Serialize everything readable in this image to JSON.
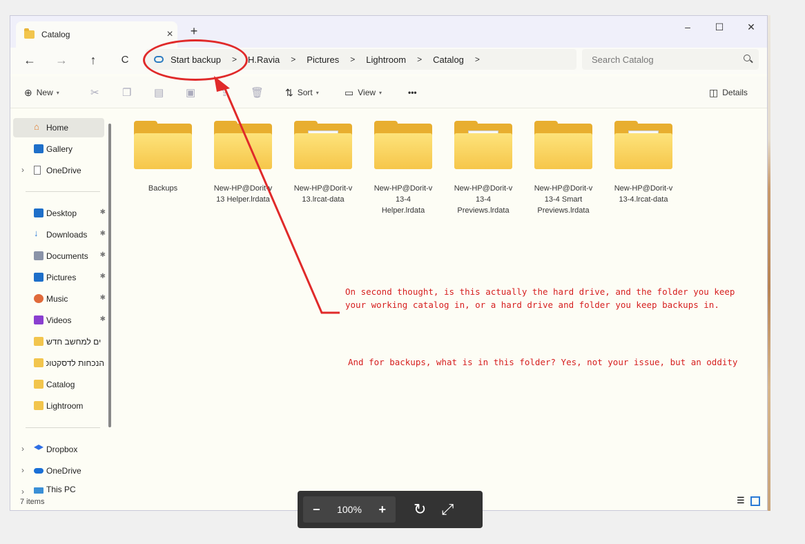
{
  "window": {
    "tab_title": "Catalog",
    "tab_close": "×",
    "new_tab": "+",
    "minimize": "–",
    "maximize": "☐",
    "close": "✕"
  },
  "nav": {
    "back": "←",
    "forward": "→",
    "up": "↑",
    "refresh": "C",
    "breadcrumb": [
      "Start backup",
      "H.Ravia",
      "Pictures",
      "Lightroom",
      "Catalog"
    ],
    "separator": ">",
    "search_placeholder": "Search Catalog"
  },
  "toolbar": {
    "new": "New",
    "sort": "Sort",
    "view": "View",
    "more": "•••",
    "details": "Details"
  },
  "sidebar": {
    "home": "Home",
    "gallery": "Gallery",
    "onedrive_top": "OneDrive",
    "desktop": "Desktop",
    "downloads": "Downloads",
    "documents": "Documents",
    "pictures": "Pictures",
    "music": "Music",
    "videos": "Videos",
    "hebrew_folder_1": "ים למחשב חדש",
    "hebrew_folder_2": "הנכחות לדסקטופ",
    "catalog": "Catalog",
    "lightroom": "Lightroom",
    "dropbox": "Dropbox",
    "onedrive_bottom": "OneDrive",
    "this_pc": "This PC",
    "pin": "📌"
  },
  "folders": [
    {
      "line1": "Backups",
      "line2": "",
      "line3": "",
      "variant": "plain"
    },
    {
      "line1": "New-HP@Dorit-v",
      "line2": "13 Helper.lrdata",
      "line3": "",
      "variant": "plain"
    },
    {
      "line1": "New-HP@Dorit-v",
      "line2": "13.lrcat-data",
      "line3": "",
      "variant": "paper"
    },
    {
      "line1": "New-HP@Dorit-v",
      "line2": "13-4",
      "line3": "Helper.lrdata",
      "variant": "plain"
    },
    {
      "line1": "New-HP@Dorit-v",
      "line2": "13-4",
      "line3": "Previews.lrdata",
      "variant": "paper"
    },
    {
      "line1": "New-HP@Dorit-v",
      "line2": "13-4 Smart",
      "line3": "Previews.lrdata",
      "variant": "plain"
    },
    {
      "line1": "New-HP@Dorit-v",
      "line2": "13-4.lrcat-data",
      "line3": "",
      "variant": "paper"
    }
  ],
  "status": {
    "item_count": "7 items"
  },
  "annotation": {
    "paragraph1": "On second thought, is this actually the hard drive, and the folder you keep your working catalog in, or a hard drive and folder you keep backups in.",
    "paragraph2": "And for backups, what is in this folder? Yes, not your issue, but an oddity",
    "color": "#d61f1f"
  },
  "zoom": {
    "minus": "−",
    "value": "100%",
    "plus": "+",
    "rotate": "↻",
    "fit": "⤢"
  }
}
